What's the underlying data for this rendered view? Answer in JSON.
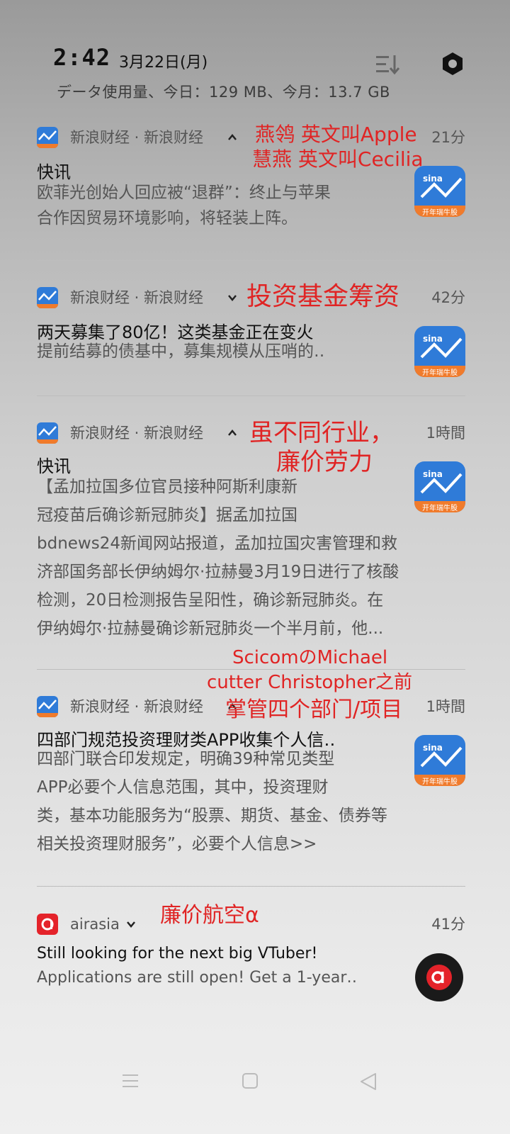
{
  "status_bar": {
    "time": "2:42",
    "date": "3月22日(月)",
    "data_usage": "データ使用量、今日：129 MB、今月：13.7 GB"
  },
  "notifications": [
    {
      "app": "新浪财经 · 新浪财经",
      "time": "21分",
      "title": "快讯",
      "body": [
        "欧菲光创始人回应被“退群”：终止与苹果",
        "合作因贸易环境影响，将轻装上阵。"
      ],
      "thumb_label": "开年瑞牛股"
    },
    {
      "app": "新浪财经 · 新浪财经",
      "time": "42分",
      "title": "两天募集了80亿！这类基金正在变火",
      "body": [
        "提前结募的债基中，募集规模从压哨的‥"
      ],
      "thumb_label": "开年瑞牛股"
    },
    {
      "app": "新浪财经 · 新浪财经",
      "time": "1時間",
      "title": "快讯",
      "body": [
        "【孟加拉国多位官员接种阿斯利康新",
        "冠疫苗后确诊新冠肺炎】据孟加拉国",
        "bdnews24新闻网站报道，孟加拉国灾害管理和救",
        "济部国务部长伊纳姆尔·拉赫曼3月19日进行了核酸",
        "检测，20日检测报告呈阳性，确诊新冠肺炎。在",
        "伊纳姆尔·拉赫曼确诊新冠肺炎一个半月前，他..."
      ],
      "thumb_label": "开年瑞牛股"
    },
    {
      "app": "新浪财经 · 新浪财经",
      "time": "1時間",
      "title": "四部门规范投资理财类APP收集个人信‥",
      "body": [
        "四部门联合印发规定，明确39种常见类型",
        "APP必要个人信息范围，其中，投资理财",
        "类，基本功能服务为“股票、期货、基金、债券等",
        "相关投资理财服务”，必要个人信息>>"
      ],
      "thumb_label": "开年瑞牛股"
    },
    {
      "app": "airasia",
      "time": "41分",
      "title": "Still looking for the next big VTuber!",
      "body": [
        "Applications are still open! Get a 1-year‥"
      ]
    }
  ],
  "annotations": [
    "燕鸰 英文叫Apple",
    "慧燕 英文叫Cecilia",
    "投资基金筹资",
    "虽不同行业，",
    "廉价劳力",
    "ScicomのMichael",
    "cutter Christopher之前",
    "掌管四个部门/项目",
    "廉价航空α"
  ],
  "colors": {
    "annotation": "#e02424",
    "sina_blue": "#2f7bd8",
    "sina_orange": "#f07b2c",
    "airasia_red": "#e4232a"
  },
  "icons": {
    "sort": "sort-icon",
    "settings": "gear-icon",
    "nav_menu": "menu-icon",
    "nav_home": "home-icon",
    "nav_back": "back-icon"
  }
}
